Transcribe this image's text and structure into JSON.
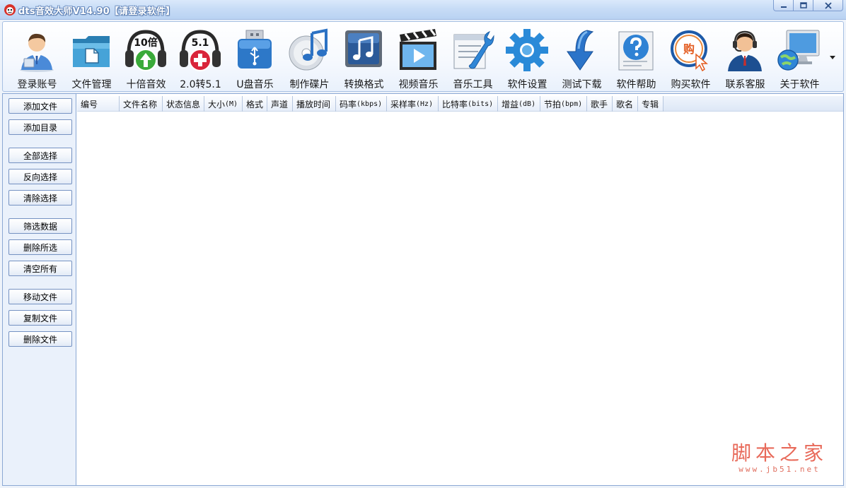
{
  "window": {
    "title": "dts音效大师V14.90【请登录软件】"
  },
  "toolbar": {
    "items": [
      {
        "label": "登录账号",
        "icon": "user-login-icon"
      },
      {
        "label": "文件管理",
        "icon": "folder-icon"
      },
      {
        "label": "十倍音效",
        "icon": "headphones-10x-icon",
        "badge": "10倍"
      },
      {
        "label": "2.0转5.1",
        "icon": "headphones-51-icon",
        "badge": "5.1"
      },
      {
        "label": "U盘音乐",
        "icon": "usb-drive-icon"
      },
      {
        "label": "制作碟片",
        "icon": "cd-music-icon"
      },
      {
        "label": "转换格式",
        "icon": "music-note-icon"
      },
      {
        "label": "视频音乐",
        "icon": "clapperboard-icon"
      },
      {
        "label": "音乐工具",
        "icon": "wrench-icon"
      },
      {
        "label": "软件设置",
        "icon": "gear-icon"
      },
      {
        "label": "测试下载",
        "icon": "download-arrow-icon"
      },
      {
        "label": "软件帮助",
        "icon": "help-icon"
      },
      {
        "label": "购买软件",
        "icon": "buy-icon",
        "badge": "购"
      },
      {
        "label": "联系客服",
        "icon": "support-agent-icon"
      },
      {
        "label": "关于软件",
        "icon": "about-computer-icon"
      }
    ]
  },
  "sidebar": {
    "buttons": [
      "添加文件",
      "添加目录",
      "全部选择",
      "反向选择",
      "清除选择",
      "筛选数据",
      "删除所选",
      "清空所有",
      "移动文件",
      "复制文件",
      "删除文件"
    ]
  },
  "table": {
    "columns": [
      {
        "label": "编号",
        "unit": ""
      },
      {
        "label": "文件名称",
        "unit": ""
      },
      {
        "label": "状态信息",
        "unit": ""
      },
      {
        "label": "大小",
        "unit": "(M)"
      },
      {
        "label": "格式",
        "unit": ""
      },
      {
        "label": "声道",
        "unit": ""
      },
      {
        "label": "播放时间",
        "unit": ""
      },
      {
        "label": "码率",
        "unit": "(kbps)"
      },
      {
        "label": "采样率",
        "unit": "(Hz)"
      },
      {
        "label": "比特率",
        "unit": "(bits)"
      },
      {
        "label": "增益",
        "unit": "(dB)"
      },
      {
        "label": "节拍",
        "unit": "(bpm)"
      },
      {
        "label": "歌手",
        "unit": ""
      },
      {
        "label": "歌名",
        "unit": ""
      },
      {
        "label": "专辑",
        "unit": ""
      }
    ],
    "rows": []
  },
  "watermark": {
    "main": "脚本之家",
    "sub": "www.jb51.net"
  }
}
